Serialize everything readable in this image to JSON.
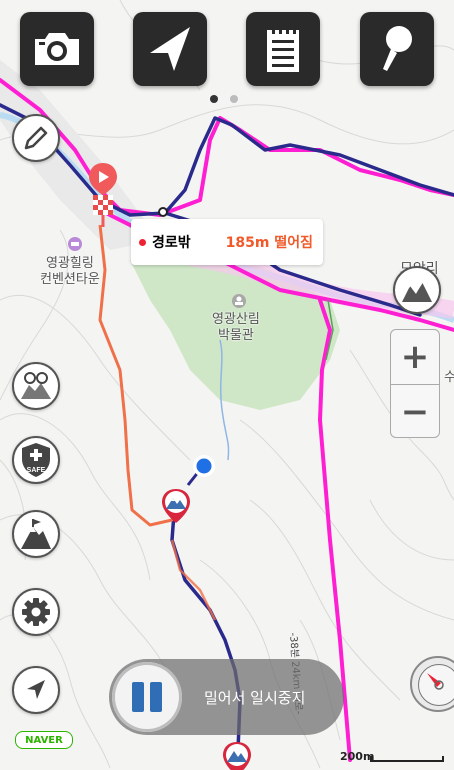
{
  "toolbar": {
    "camera": "camera-icon",
    "navigate": "navigation-arrow-icon",
    "notes": "notepad-icon",
    "voice": "microphone-icon"
  },
  "offroute": {
    "status": "경로밖",
    "distance": "185m 떨어짐"
  },
  "labels": {
    "healing_line1": "영광힐링",
    "healing_line2": "컨벤션타운",
    "museum_line1": "영광산림",
    "museum_line2": "박물관",
    "village": "모악리",
    "edge_right": "수",
    "trail": "-38분 24km 대로-"
  },
  "zoom": {
    "in": "+",
    "out": "−"
  },
  "pause": {
    "label": "밀어서 일시중지"
  },
  "branding": {
    "naver": "NAVER"
  },
  "scale": {
    "label": "200m"
  },
  "side_buttons": {
    "edit": "pencil-icon",
    "community": "people-map-icon",
    "safe": "SAFE",
    "summit": "mountain-flag-icon",
    "settings": "gear-icon",
    "locate": "locate-arrow-icon",
    "elevation": "elevation-chart-icon"
  },
  "colors": {
    "route_magenta": "#ff1fd2",
    "track_navy": "#2a2a8c",
    "offroute_orange": "#f0704a",
    "accent_red": "#e23"
  }
}
